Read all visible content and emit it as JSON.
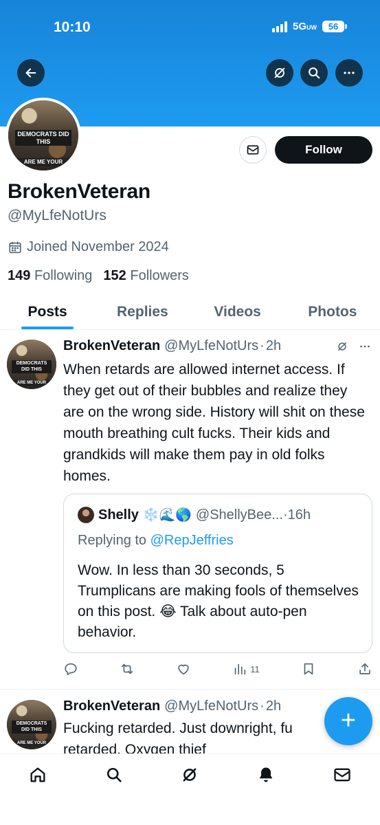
{
  "status_bar": {
    "time": "10:10",
    "network": "5G",
    "network_suffix": "UW",
    "battery": "56"
  },
  "top_bar": {
    "back_icon": "arrow-left-icon",
    "grok_icon": "grok-icon",
    "search_icon": "search-icon",
    "more_icon": "more-icon"
  },
  "profile": {
    "avatar_text_top": "DEMOCRATS DID THIS",
    "avatar_text_bottom": "ARE ME YOUR",
    "message_icon": "envelope-icon",
    "follow_label": "Follow",
    "display_name": "BrokenVeteran",
    "handle": "@MyLfeNotUrs",
    "joined": "Joined November 2024",
    "following_count": "149",
    "following_label": "Following",
    "followers_count": "152",
    "followers_label": "Followers"
  },
  "tabs": [
    {
      "label": "Posts",
      "active": true
    },
    {
      "label": "Replies"
    },
    {
      "label": "Videos"
    },
    {
      "label": "Photos"
    }
  ],
  "tweets": [
    {
      "name": "BrokenVeteran",
      "handle": "@MyLfeNotUrs",
      "separator": "·",
      "time": "2h",
      "text": "When retards are allowed internet access. If they get out of their bubbles and realize they are on the wrong side. History will shit on these mouth breathing cult fucks. Their kids and grandkids will make them pay in old folks homes.",
      "quote": {
        "name": "Shelly",
        "emojis": "❄️🌊🌎",
        "handle": "@ShellyBee...",
        "separator": "·",
        "time": "16h",
        "replying_prefix": "Replying to",
        "replying_to": "@RepJeffries",
        "text": "Wow. In less than 30 seconds, 5 Trumplicans are making fools of themselves on this post. 😂 Talk about auto-pen behavior."
      },
      "views": "11"
    },
    {
      "name": "BrokenVeteran",
      "handle": "@MyLfeNotUrs",
      "separator": "·",
      "time": "2h",
      "text": "Fucking retarded. Just downright, fu retarded. Oxygen thief"
    }
  ],
  "fab_label": "+",
  "bottom_nav": [
    "home-icon",
    "search-icon",
    "grok-icon",
    "notifications-icon",
    "messages-icon"
  ],
  "colors": {
    "accent": "#1d9bf0",
    "text": "#0f1419",
    "muted": "#536471"
  }
}
